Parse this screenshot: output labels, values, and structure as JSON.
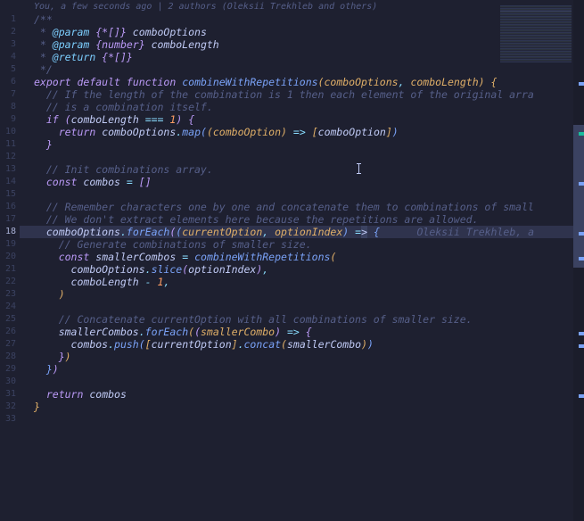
{
  "header": {
    "blame": "You, a few seconds ago | 2 authors (Oleksii Trekhleb and others)"
  },
  "active_line": 18,
  "inline_blame": "Oleksii Trekhleb, a",
  "lines": {
    "1": "/**",
    "2a": " * ",
    "2b": "@param",
    "2c": " {*[]}",
    "2d": " comboOptions",
    "3a": " * ",
    "3b": "@param",
    "3c": " {number}",
    "3d": " comboLength",
    "4a": " * ",
    "4b": "@return",
    "4c": " {*[]}",
    "5": " */",
    "6a": "export",
    "6b": "default",
    "6c": "function",
    "6d": "combineWithRepetitions",
    "6e": "comboOptions",
    "6f": "comboLength",
    "7": "  // If the length of the combination is 1 then each element of the original arra",
    "8": "  // is a combination itself.",
    "9a": "if",
    "9b": "comboLength",
    "9c": "===",
    "9d": "1",
    "10a": "return",
    "10b": "comboOptions",
    "10c": "map",
    "10d": "comboOption",
    "10e": "comboOption",
    "13": "  // Init combinations array.",
    "14a": "const",
    "14b": "combos",
    "14c": "[]",
    "16": "  // Remember characters one by one and concatenate them to combinations of small",
    "17": "  // We don't extract elements here because the repetitions are allowed.",
    "18a": "comboOptions",
    "18b": "forEach",
    "18c": "currentOption",
    "18d": "optionIndex",
    "19": "    // Generate combinations of smaller size.",
    "20a": "const",
    "20b": "smallerCombos",
    "20c": "combineWithRepetitions",
    "21a": "comboOptions",
    "21b": "slice",
    "21c": "optionIndex",
    "22a": "comboLength",
    "22b": "1",
    "25": "    // Concatenate currentOption with all combinations of smaller size.",
    "26a": "smallerCombos",
    "26b": "forEach",
    "26c": "smallerCombo",
    "27a": "combos",
    "27b": "push",
    "27c": "currentOption",
    "27d": "concat",
    "27e": "smallerCombo",
    "31a": "return",
    "31b": "combos"
  }
}
